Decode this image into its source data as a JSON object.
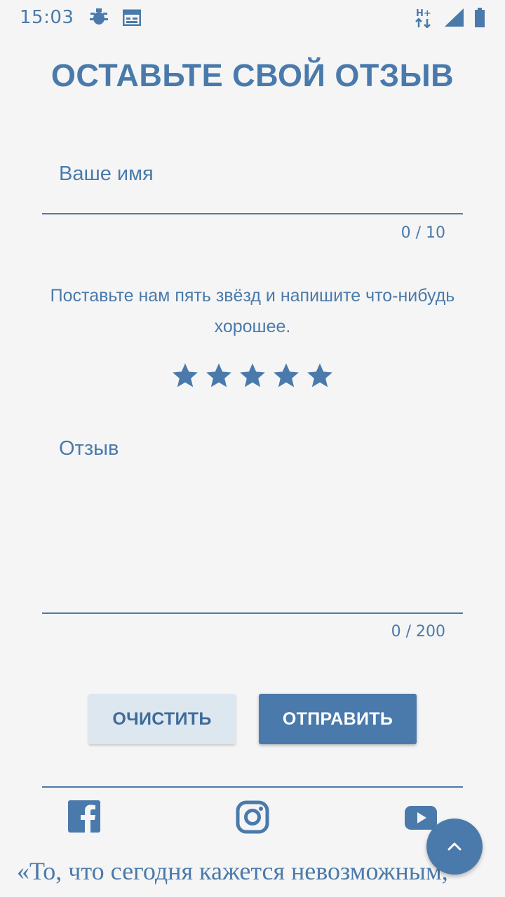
{
  "status_bar": {
    "time": "15:03",
    "icons": [
      "bug-icon",
      "calendar-icon",
      "network-hplus-icon",
      "signal-icon",
      "battery-icon"
    ],
    "network_label": "H+"
  },
  "title": "ОСТАВЬТЕ СВОЙ ОТЗЫВ",
  "name_field": {
    "label": "Ваше имя",
    "value": "",
    "counter": "0 / 10"
  },
  "prompt": "Поставьте нам пять звёзд и напишите что-нибудь хорошее.",
  "rating": {
    "value": 5,
    "max": 5,
    "icon": "star-icon"
  },
  "review_field": {
    "label": "Отзыв",
    "value": "",
    "counter": "0 / 200"
  },
  "buttons": {
    "clear": "ОЧИСТИТЬ",
    "submit": "ОТПРАВИТЬ"
  },
  "social": [
    "facebook-icon",
    "instagram-icon",
    "youtube-icon"
  ],
  "fab_icon": "chevron-up-icon",
  "quote": "«То, что сегодня кажется невозможным,",
  "colors": {
    "accent": "#4a7aab",
    "background": "#f5f5f5",
    "button_secondary_bg": "#dde7f0",
    "button_primary_text": "#ffffff"
  }
}
